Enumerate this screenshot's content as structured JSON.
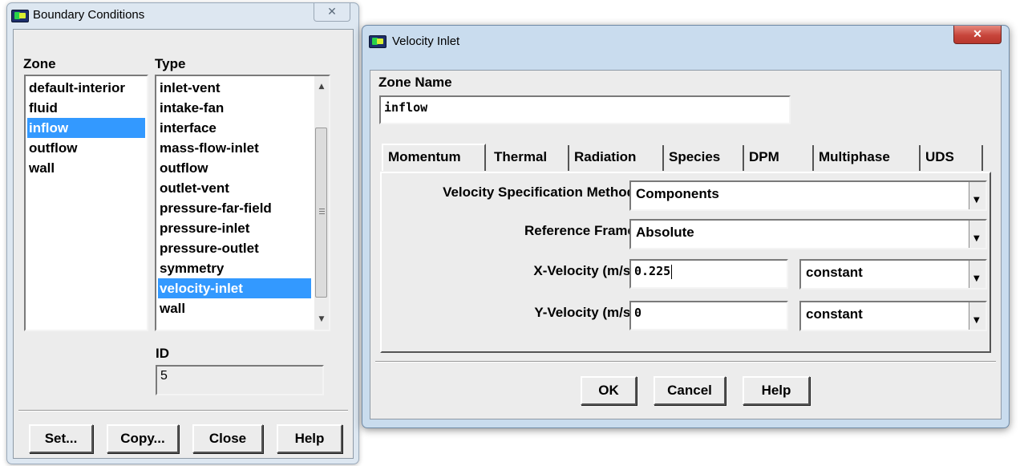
{
  "boundary_conditions": {
    "title": "Boundary Conditions",
    "zone_label": "Zone",
    "type_label": "Type",
    "zones": [
      "default-interior",
      "fluid",
      "inflow",
      "outflow",
      "wall"
    ],
    "selected_zone": "inflow",
    "types": [
      "inlet-vent",
      "intake-fan",
      "interface",
      "mass-flow-inlet",
      "outflow",
      "outlet-vent",
      "pressure-far-field",
      "pressure-inlet",
      "pressure-outlet",
      "symmetry",
      "velocity-inlet",
      "wall"
    ],
    "selected_type": "velocity-inlet",
    "id_label": "ID",
    "id_value": "5",
    "buttons": {
      "set": "Set...",
      "copy": "Copy...",
      "close": "Close",
      "help": "Help"
    }
  },
  "velocity_inlet": {
    "title": "Velocity Inlet",
    "zone_name_label": "Zone Name",
    "zone_name_value": "inflow",
    "tabs": [
      "Momentum",
      "Thermal",
      "Radiation",
      "Species",
      "DPM",
      "Multiphase",
      "UDS"
    ],
    "active_tab": "Momentum",
    "fields": {
      "velocity_method_label": "Velocity Specification Method",
      "velocity_method_value": "Components",
      "reference_frame_label": "Reference Frame",
      "reference_frame_value": "Absolute",
      "x_velocity_label": "X-Velocity (m/s)",
      "x_velocity_value": "0.225",
      "x_velocity_profile": "constant",
      "y_velocity_label": "Y-Velocity (m/s)",
      "y_velocity_value": "0",
      "y_velocity_profile": "constant"
    },
    "buttons": {
      "ok": "OK",
      "cancel": "Cancel",
      "help": "Help"
    }
  },
  "colors": {
    "selection": "#3399ff",
    "frame": "#c9dcee",
    "client": "#ececec",
    "close_button": "#c7453b"
  },
  "icons": [
    "fluent-app-icon",
    "close-icon",
    "scroll-up-icon",
    "scroll-down-icon",
    "chevron-down-icon"
  ]
}
